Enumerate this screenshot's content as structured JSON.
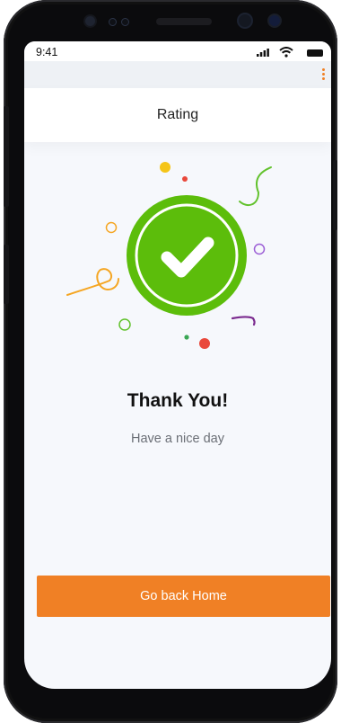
{
  "status_bar": {
    "time": "9:41"
  },
  "header": {
    "title": "Rating"
  },
  "main": {
    "heading": "Thank You!",
    "subtitle": "Have a nice day"
  },
  "actions": {
    "home_button": "Go back Home"
  },
  "colors": {
    "accent": "#f08025",
    "success": "#5cbd0b",
    "background": "#f6f8fc"
  },
  "icons": [
    "menu-more-icon",
    "check-circle-icon",
    "signal-icon",
    "wifi-icon",
    "battery-icon"
  ]
}
